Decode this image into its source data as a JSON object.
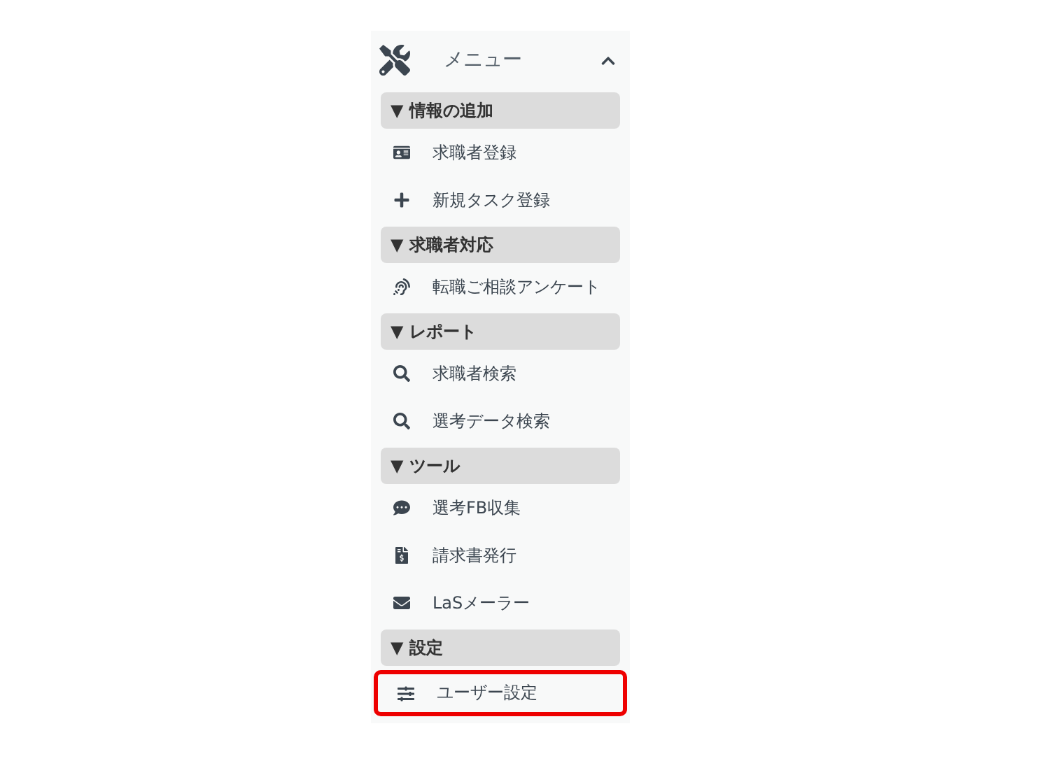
{
  "menu": {
    "title": "メニュー",
    "expanded": true
  },
  "sections": [
    {
      "label": "▼ 情報の追加",
      "items": [
        {
          "label": "求職者登録",
          "kind": "idcard",
          "highlighted": false
        },
        {
          "label": "新規タスク登録",
          "kind": "plus",
          "highlighted": false
        }
      ]
    },
    {
      "label": "▼ 求職者対応",
      "items": [
        {
          "label": "転職ご相談アンケート",
          "kind": "ear",
          "highlighted": false
        }
      ]
    },
    {
      "label": "▼ レポート",
      "items": [
        {
          "label": "求職者検索",
          "kind": "search",
          "highlighted": false
        },
        {
          "label": "選考データ検索",
          "kind": "search",
          "highlighted": false
        }
      ]
    },
    {
      "label": "▼ ツール",
      "items": [
        {
          "label": "選考FB収集",
          "kind": "comment",
          "highlighted": false
        },
        {
          "label": "請求書発行",
          "kind": "invoice",
          "highlighted": false
        },
        {
          "label": "LaSメーラー",
          "kind": "mail",
          "highlighted": false
        }
      ]
    },
    {
      "label": "▼ 設定",
      "items": [
        {
          "label": "ユーザー設定",
          "kind": "sliders",
          "highlighted": true
        }
      ]
    }
  ]
}
